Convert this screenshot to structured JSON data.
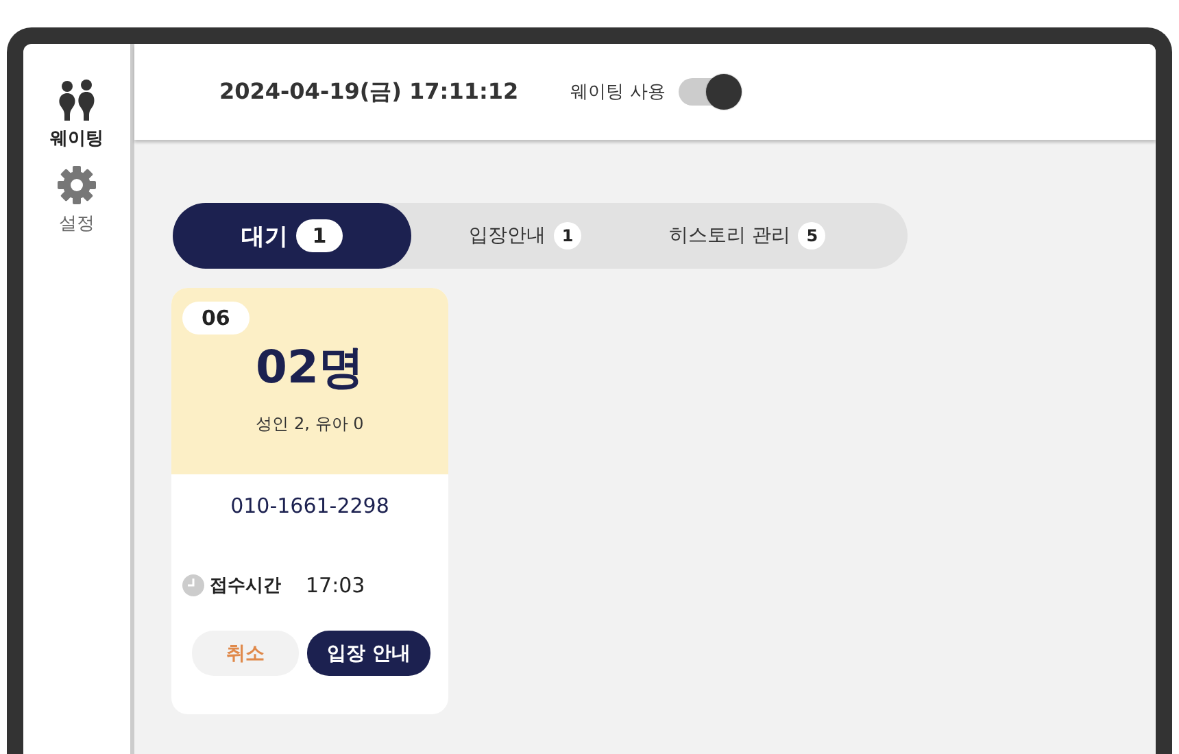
{
  "sidebar": {
    "items": [
      {
        "kind": "people",
        "label": "웨이팅",
        "selected": true
      },
      {
        "kind": "gear",
        "label": "설정",
        "selected": false
      }
    ]
  },
  "header": {
    "datetime": "2024-04-19(금) 17:11:12",
    "toggle": {
      "label": "웨이팅 사용",
      "on": true
    }
  },
  "tabs": [
    {
      "label": "대기",
      "count": "1",
      "selected": true
    },
    {
      "label": "입장안내",
      "count": "1",
      "selected": false
    },
    {
      "label": "히스토리 관리",
      "count": "5",
      "selected": false
    }
  ],
  "cards": [
    {
      "number": "06",
      "party": "02명",
      "detail": "성인 2, 유아 0",
      "phone": "010-1661-2298",
      "time_label": "접수시간",
      "time": "17:03",
      "cancel": "취소",
      "admit": "입장 안내"
    }
  ]
}
